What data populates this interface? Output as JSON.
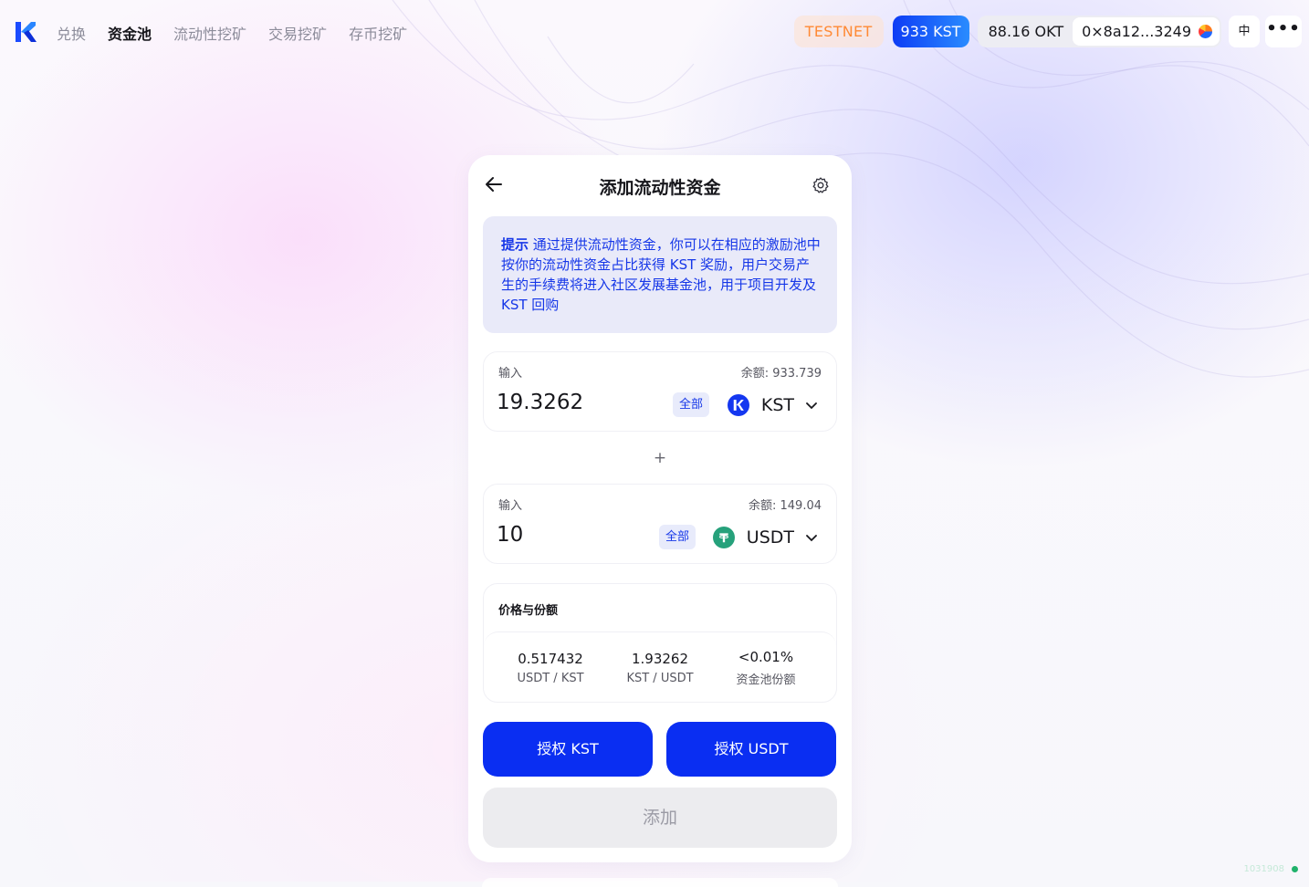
{
  "nav": {
    "items": [
      {
        "label": "兑换",
        "active": false
      },
      {
        "label": "资金池",
        "active": true
      },
      {
        "label": "流动性挖矿",
        "active": false
      },
      {
        "label": "交易挖矿",
        "active": false
      },
      {
        "label": "存币挖矿",
        "active": false
      }
    ]
  },
  "header": {
    "network": "TESTNET",
    "kst_balance": "933 KST",
    "okt_balance": "88.16 OKT",
    "address": "0×8a12...3249",
    "language": "中",
    "more": "•••"
  },
  "card": {
    "title": "添加流动性资金",
    "tip_label": "提示",
    "tip_text": "通过提供流动性资金，你可以在相应的激励池中按你的流动性资金占比获得 KST 奖励，用户交易产生的手续费将进入社区发展基金池，用于项目开发及KST 回购",
    "input_a": {
      "label": "输入",
      "balance": "余额: 933.739",
      "amount": "19.3262",
      "max_label": "全部",
      "token": "KST"
    },
    "plus": "+",
    "input_b": {
      "label": "输入",
      "balance": "余额: 149.04",
      "amount": "10",
      "max_label": "全部",
      "token": "USDT"
    },
    "price": {
      "title": "价格与份额",
      "cols": [
        {
          "value": "0.517432",
          "unit": "USDT / KST"
        },
        {
          "value": "1.93262",
          "unit": "KST / USDT"
        },
        {
          "value": "<0.01%",
          "unit": "资金池份额"
        }
      ]
    },
    "approve_kst": "授权 KST",
    "approve_usdt": "授权 USDT",
    "add": "添加"
  },
  "footer": {
    "block": "1031908"
  },
  "colors": {
    "primary": "#0a2ef2",
    "tip_bg": "#e9eaf9",
    "testnet": "#ff8a35",
    "usdt": "#26a17b"
  }
}
